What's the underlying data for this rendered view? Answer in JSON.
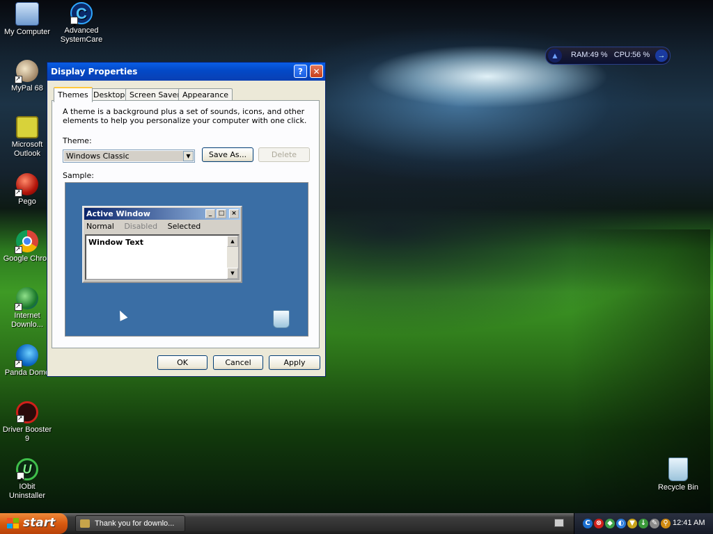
{
  "desktop": {
    "icons": [
      {
        "label": "My Computer"
      },
      {
        "label": "Advanced SystemCare"
      },
      {
        "label": "MyPal 68"
      },
      {
        "label": "Microsoft Outlook"
      },
      {
        "label": "Pego"
      },
      {
        "label": "Google Chron"
      },
      {
        "label": "Internet Downlo..."
      },
      {
        "label": "Panda Dome"
      },
      {
        "label": "Driver Booster 9"
      },
      {
        "label": "IObit Uninstaller"
      },
      {
        "label": "Recycle Bin"
      }
    ]
  },
  "gadget": {
    "ram_label": "RAM:",
    "ram_value": "49 %",
    "cpu_label": "CPU:",
    "cpu_value": "56 %",
    "ram_percent": 49,
    "cpu_percent": 56
  },
  "dialog": {
    "title": "Display Properties",
    "help_glyph": "?",
    "close_glyph": "✕",
    "tabs": [
      {
        "label": "Themes",
        "active": true
      },
      {
        "label": "Desktop",
        "active": false
      },
      {
        "label": "Screen Saver",
        "active": false
      },
      {
        "label": "Appearance",
        "active": false
      }
    ],
    "description": "A theme is a background plus a set of sounds, icons, and other elements to help you personalize your computer with one click.",
    "theme_label": "Theme:",
    "theme_value": "Windows Classic",
    "save_as_label": "Save As...",
    "delete_label": "Delete",
    "sample_label": "Sample:",
    "sample": {
      "window_title": "Active Window",
      "menu": [
        "Normal",
        "Disabled",
        "Selected"
      ],
      "window_text": "Window Text"
    },
    "ok_label": "OK",
    "cancel_label": "Cancel",
    "apply_label": "Apply"
  },
  "taskbar": {
    "start_label": "start",
    "task_label": "Thank you for downlo...",
    "clock": "12:41 AM"
  },
  "colors": {
    "titlebar": "#0349c6",
    "start": "#d85a10",
    "sample_bg": "#3a6ea5",
    "close": "#c63e18"
  }
}
